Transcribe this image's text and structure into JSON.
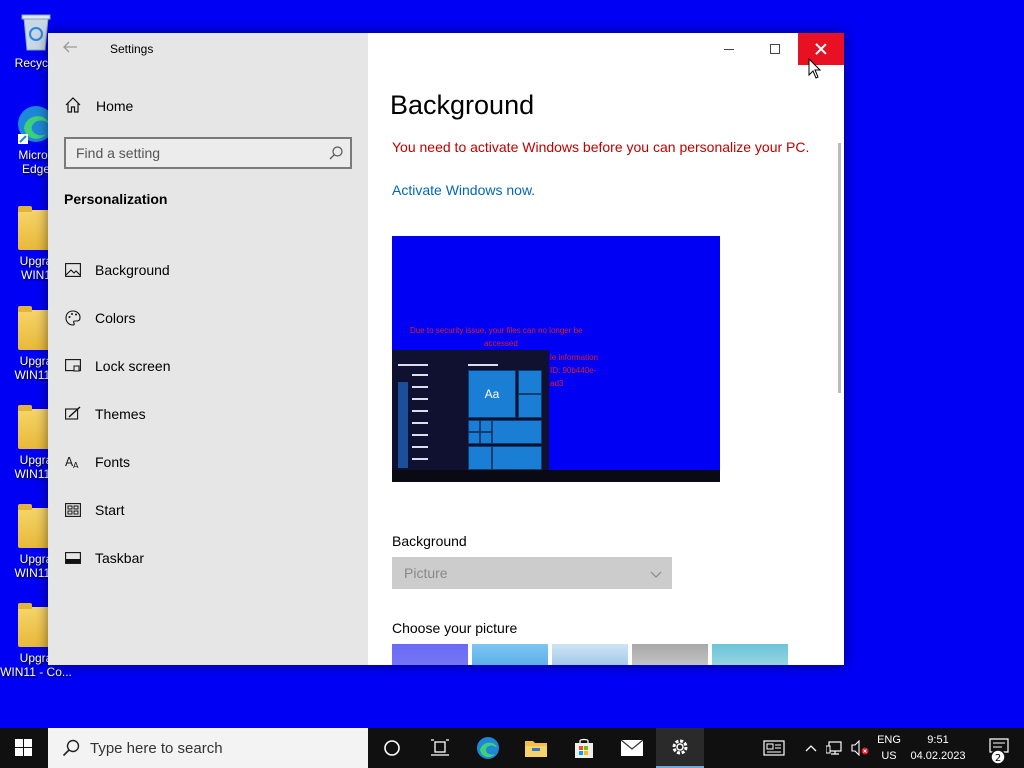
{
  "desktop": {
    "icons": [
      {
        "label": "Recycle"
      },
      {
        "label": "Micros",
        "label2": "Edge"
      },
      {
        "label": "Upgra",
        "label2": "WIN1"
      },
      {
        "label": "Upgra",
        "label2": "WIN11 -"
      },
      {
        "label": "Upgra",
        "label2": "WIN11 -"
      },
      {
        "label": "Upgra",
        "label2": "WIN11 -"
      },
      {
        "label": "Upgra",
        "label2": "WIN11 - Co..."
      }
    ]
  },
  "window": {
    "title": "Settings",
    "sidebar": {
      "home_label": "Home",
      "search_placeholder": "Find a setting",
      "section_title": "Personalization",
      "items": [
        {
          "label": "Background",
          "icon": "picture-icon"
        },
        {
          "label": "Colors",
          "icon": "palette-icon"
        },
        {
          "label": "Lock screen",
          "icon": "lock-screen-icon"
        },
        {
          "label": "Themes",
          "icon": "themes-icon"
        },
        {
          "label": "Fonts",
          "icon": "fonts-icon"
        },
        {
          "label": "Start",
          "icon": "start-icon"
        },
        {
          "label": "Taskbar",
          "icon": "taskbar-icon"
        }
      ]
    },
    "content": {
      "page_title": "Background",
      "warning": "You need to activate Windows before you can personalize your PC.",
      "activate_link": "Activate Windows now.",
      "preview": {
        "line1": "Due to security issue, your files can no longer be",
        "line2": "accessed",
        "line3": "le information",
        "line4": "ID: 90b440e-",
        "line5": "ad3",
        "tile_label": "Aa"
      },
      "background_label": "Background",
      "background_value": "Picture",
      "choose_label": "Choose your picture"
    }
  },
  "taskbar": {
    "search_placeholder": "Type here to search",
    "lang_top": "ENG",
    "lang_bottom": "US",
    "time": "9:51",
    "date": "04.02.2023",
    "notification_count": "2"
  },
  "colors": {
    "desktop": "#0000f5",
    "close_button": "#e81123",
    "warning": "#c00000",
    "link": "#0067b8"
  }
}
